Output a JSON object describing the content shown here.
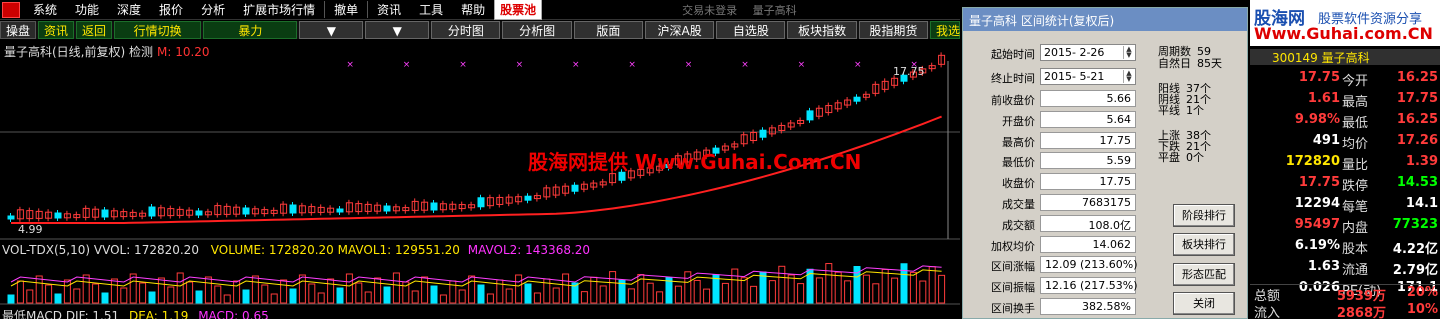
{
  "menubar": {
    "items": [
      "系统",
      "功能",
      "深度",
      "报价",
      "分析",
      "扩展市场行情",
      "撤单",
      "资讯",
      "工具",
      "帮助"
    ],
    "active_item": "股票池",
    "status": [
      "交易未登录",
      "量子高科"
    ]
  },
  "toolbar": {
    "buttons": [
      "操盘",
      "资讯",
      "返回",
      "行情切换",
      "暴力",
      "▼",
      "▼",
      "分时图",
      "分析图",
      "版面",
      "沪深A股",
      "自选股",
      "板块指数",
      "股指期货",
      "我选"
    ]
  },
  "chart": {
    "title": "量子高科(日线,前复权) 检测",
    "title_marker": "M: 10.20",
    "watermark": "股海网提供 Www.Guhai.Com.CN",
    "high_label": "17.75",
    "low_label": "4.99",
    "volume_title": "VOL-TDX(5,10)",
    "volume_vvol": "VVOL: 172820.20",
    "volume_mavol1": "VOLUME: 172820.20  MAVOL1: 129551.20",
    "volume_mavol2": "MAVOL2: 143368.20",
    "macd_title": "最低MACD",
    "macd_dif": "DIF: 1.51",
    "macd_dea": "DEA: 1.19",
    "macd_val": "MACD: 0.65",
    "colors": {
      "up": "#ff3b3b",
      "down": "#00e5ff",
      "ma": "#ff2020",
      "mavol1": "#ffe600",
      "mavol2": "#ff40ff"
    }
  },
  "dialog": {
    "title": "量子高科  区间统计(复权后)",
    "start_label": "起始时间",
    "start_value": "2015- 2-26",
    "end_label": "终止时间",
    "end_value": "2015- 5-21",
    "fields": [
      {
        "label": "前收盘价",
        "value": "5.66"
      },
      {
        "label": "开盘价",
        "value": "5.64"
      },
      {
        "label": "最高价",
        "value": "17.75"
      },
      {
        "label": "最低价",
        "value": "5.59"
      },
      {
        "label": "收盘价",
        "value": "17.75"
      },
      {
        "label": "成交量",
        "value": "7683175"
      },
      {
        "label": "成交额",
        "value": "108.0亿"
      },
      {
        "label": "加权均价",
        "value": "14.062"
      },
      {
        "label": "区间涨幅",
        "value": "12.09 (213.60%)"
      },
      {
        "label": "区间振幅",
        "value": "12.16 (217.53%)"
      },
      {
        "label": "区间换手",
        "value": "382.58%"
      }
    ],
    "stats": [
      {
        "label": "周期数",
        "value": "59"
      },
      {
        "label": "自然日",
        "value": "85天"
      },
      {
        "label": "阳线",
        "value": "37个"
      },
      {
        "label": "阴线",
        "value": "21个"
      },
      {
        "label": "平线",
        "value": "1个"
      },
      {
        "label": "上涨",
        "value": "38个"
      },
      {
        "label": "下跌",
        "value": "21个"
      },
      {
        "label": "平盘",
        "value": "0个"
      }
    ],
    "buttons": [
      "阶段排行",
      "板块排行",
      "形态匹配",
      "关闭"
    ]
  },
  "quote": {
    "banner_brand": "股海网",
    "banner_tagline": "股票软件资源分享",
    "banner_url": "Www.Guhai.com.CN",
    "header": "300149 量子高科",
    "rows": [
      {
        "v1": "17.75",
        "label": "今开",
        "v2": "16.25",
        "c1": "#ff3b3b",
        "c2": "#ff3b3b"
      },
      {
        "v1": "1.61",
        "label": "最高",
        "v2": "17.75",
        "c1": "#ff3b3b",
        "c2": "#ff3b3b"
      },
      {
        "v1": "9.98%",
        "label": "最低",
        "v2": "16.25",
        "c1": "#ff3b3b",
        "c2": "#ff3b3b"
      },
      {
        "v1": "491",
        "label": "均价",
        "v2": "17.26",
        "c1": "#ffffff",
        "c2": "#ff3b3b"
      },
      {
        "v1": "172820",
        "label": "量比",
        "v2": "1.39",
        "c1": "#ffe600",
        "c2": "#ff3b3b"
      },
      {
        "v1": "17.75",
        "label": "跌停",
        "v2": "14.53",
        "c1": "#ff3b3b",
        "c2": "#00ff00"
      },
      {
        "v1": "12294",
        "label": "每笔",
        "v2": "14.1",
        "c1": "#ffffff",
        "c2": "#ffffff"
      },
      {
        "v1": "95497",
        "label": "内盘",
        "v2": "77323",
        "c1": "#ff3b3b",
        "c2": "#00ff00"
      },
      {
        "v1": "6.19%",
        "label": "股本",
        "v2": "4.22亿",
        "c1": "#ffffff",
        "c2": "#ffffff"
      },
      {
        "v1": "1.63",
        "label": "流通",
        "v2": "2.79亿",
        "c1": "#ffffff",
        "c2": "#ffffff"
      },
      {
        "v1": "0.026",
        "label": "PE(动)",
        "v2": "171.1",
        "c1": "#ffffff",
        "c2": "#ffffff"
      }
    ],
    "bottom_rows": [
      {
        "label": "总额",
        "value": "5939万",
        "pct": "20%"
      },
      {
        "label": "流入",
        "value": "2868万",
        "pct": "10%"
      }
    ]
  }
}
